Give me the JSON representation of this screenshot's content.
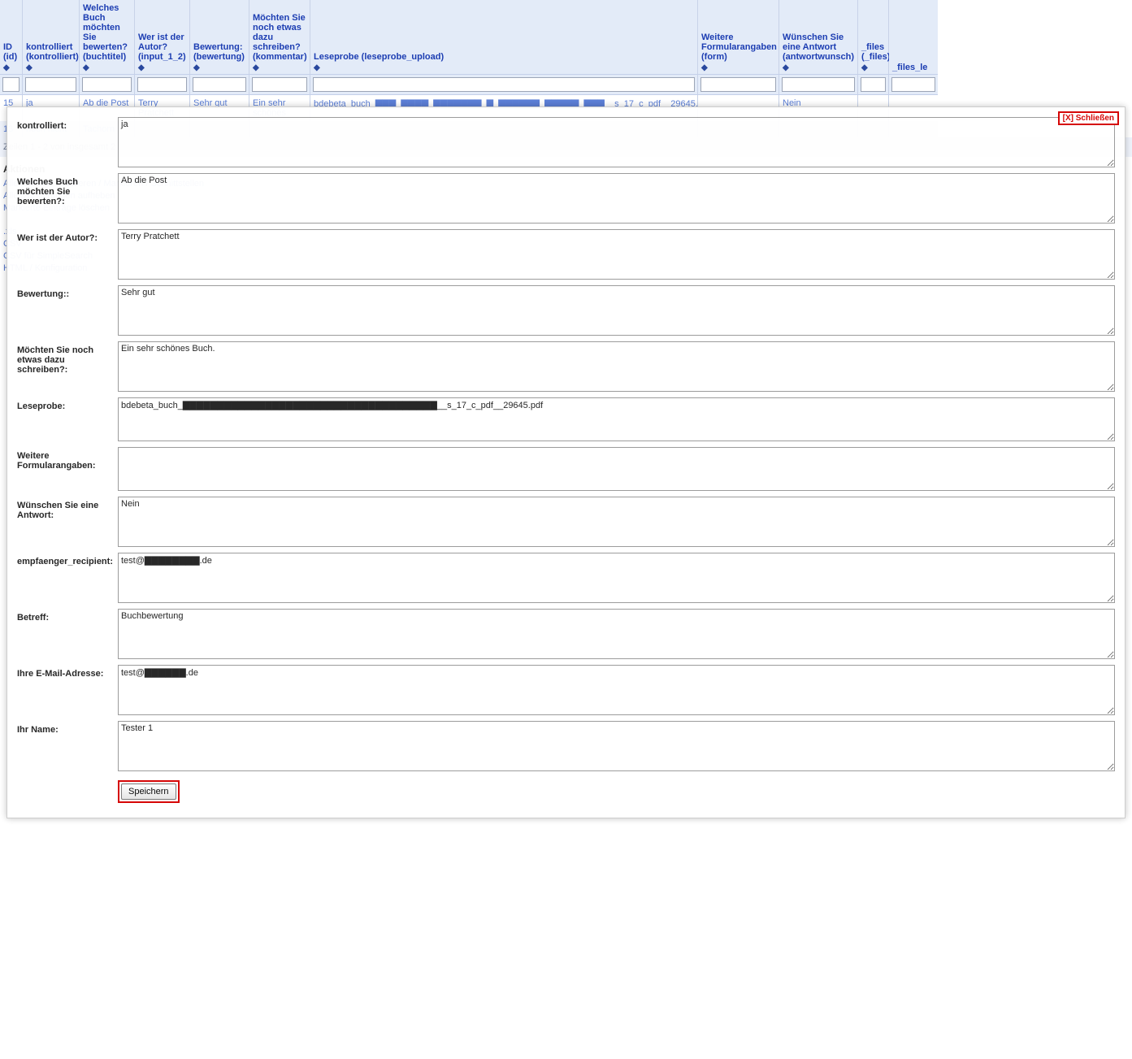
{
  "grid": {
    "columns": [
      {
        "label": "ID (id)",
        "sort": "◆"
      },
      {
        "label": "kontrolliert (kontrolliert)",
        "sort": "◆"
      },
      {
        "label": "Welches Buch möchten Sie bewerten? (buchtitel)",
        "sort": "◆"
      },
      {
        "label": "Wer ist der Autor? (input_1_2)",
        "sort": "◆"
      },
      {
        "label": "Bewertung: (bewertung)",
        "sort": "◆"
      },
      {
        "label": "Möchten Sie noch etwas dazu schreiben? (kommentar)",
        "sort": "◆"
      },
      {
        "label": "Leseprobe (leseprobe_upload)",
        "sort": "◆"
      },
      {
        "label": "Weitere Formularangaben (form)",
        "sort": "◆"
      },
      {
        "label": "Wünschen Sie eine Antwort (antwortwunsch)",
        "sort": "◆"
      },
      {
        "label": "_files (_files)",
        "sort": "◆"
      },
      {
        "label": "_files_le",
        "sort": ""
      }
    ],
    "rows": [
      {
        "id": "15",
        "kontrolliert": "ja",
        "buchtitel": "Ab die Post",
        "autor": "Terry Pratchett",
        "bewertung": "Sehr gut",
        "kommentar": "Ein sehr schönes",
        "leseprobe": "bdebeta_buch_▇▇▇_▇▇▇▇_▇▇▇▇▇▇▇_▇_▇▇▇▇▇▇_▇▇▇▇▇_▇▇▇__s_17_c_pdf__29645.pdf",
        "form": "",
        "antwort": "Nein",
        "files": "",
        "files_le": ""
      },
      {
        "id": "13",
        "kontrolliert": "noch nicht",
        "buchtitel": "Tachorn",
        "autor": "",
        "bewertung": "",
        "kommentar": "",
        "leseprobe": "",
        "form": "",
        "antwort": "",
        "files": "",
        "files_le": ""
      }
    ],
    "results": "Zeilen 1 - 2 von insgesamt 2"
  },
  "bg_actions": {
    "title": "Aktionen",
    "items": [
      "Alle Einträge markieren / Markieren / Schnittstellen",
      "Alle Markierungen aufheben",
      "Markierte Einträge löschen"
    ],
    "export_title": "",
    "exports": [
      ".xls",
      "CSV",
      "CSV für SimpleSearch",
      "HTML / Konfiguration"
    ]
  },
  "modal": {
    "close": "[X] Schließen",
    "save_label": "Speichern",
    "fields": {
      "kontrolliert": {
        "label": "kontrolliert:",
        "value": "ja"
      },
      "buchtitel": {
        "label": "Welches Buch möchten Sie bewerten?:",
        "value": "Ab die Post"
      },
      "autor": {
        "label": "Wer ist der Autor?:",
        "value": "Terry Pratchett"
      },
      "bewertung": {
        "label": "Bewertung::",
        "value": "Sehr gut"
      },
      "kommentar": {
        "label": "Möchten Sie noch etwas dazu schreiben?:",
        "value": "Ein sehr schönes Buch."
      },
      "leseprobe": {
        "label": "Leseprobe:",
        "value": "bdebeta_buch_▇▇▇▇▇▇▇▇▇▇▇▇▇▇▇▇▇▇▇▇▇▇▇▇▇▇▇▇▇▇▇▇▇▇▇▇▇__s_17_c_pdf__29645.pdf"
      },
      "formularangaben": {
        "label": "Weitere Formularangaben:",
        "value": ""
      },
      "antwortwunsch": {
        "label": "Wünschen Sie eine Antwort:",
        "value": "Nein"
      },
      "empfaenger": {
        "label": "empfaenger_recipient:",
        "value": "test@▇▇▇▇▇▇▇▇.de"
      },
      "betreff": {
        "label": "Betreff:",
        "value": "Buchbewertung"
      },
      "email": {
        "label": "Ihre E-Mail-Adresse:",
        "value": "test@▇▇▇▇▇▇.de"
      },
      "name": {
        "label": "Ihr Name:",
        "value": "Tester 1"
      }
    }
  }
}
